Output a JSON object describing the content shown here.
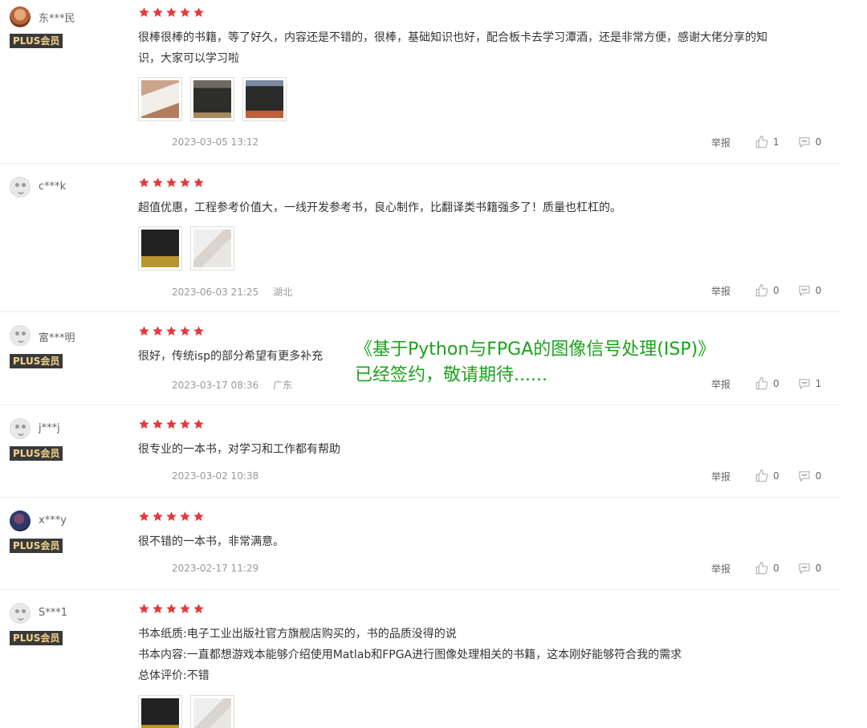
{
  "reviews": [
    {
      "username": "东***民",
      "avatar": "user-photo-avatar",
      "badge": "PLUS会员",
      "rating": 5,
      "text_lines": [
        "很棒很棒的书籍，等了好久，内容还是不错的，很棒，基础知识也好，配合板卡去学习潭酒，还是非常方便，感谢大佬分享的知",
        "识，大家可以学习啦"
      ],
      "images": 3,
      "date": "2023-03-05 13:12",
      "location": "",
      "report": "举报",
      "likes": "1",
      "comments": "0"
    },
    {
      "username": "c***k",
      "avatar": "default-avatar",
      "badge": "",
      "rating": 5,
      "text_lines": [
        "超值优惠，工程参考价值大，一线开发参考书，良心制作，比翻译类书籍强多了！质量也杠杠的。"
      ],
      "images": 2,
      "date": "2023-06-03 21:25",
      "location": "湖北",
      "report": "举报",
      "likes": "0",
      "comments": "0"
    },
    {
      "username": "富***明",
      "avatar": "default-avatar",
      "badge": "PLUS会员",
      "rating": 5,
      "text_lines": [
        "很好，传统isp的部分希望有更多补充"
      ],
      "images": 0,
      "date": "2023-03-17 08:36",
      "location": "广东",
      "report": "举报",
      "likes": "0",
      "comments": "1"
    },
    {
      "username": "j***j",
      "avatar": "default-avatar",
      "badge": "PLUS会员",
      "rating": 5,
      "text_lines": [
        "很专业的一本书，对学习和工作都有帮助"
      ],
      "images": 0,
      "date": "2023-03-02 10:38",
      "location": "",
      "report": "举报",
      "likes": "0",
      "comments": "0"
    },
    {
      "username": "x***y",
      "avatar": "user-photo-avatar",
      "badge": "PLUS会员",
      "rating": 5,
      "text_lines": [
        "很不错的一本书，非常满意。"
      ],
      "images": 0,
      "date": "2023-02-17 11:29",
      "location": "",
      "report": "举报",
      "likes": "0",
      "comments": "0"
    },
    {
      "username": "S***1",
      "avatar": "default-avatar",
      "badge": "PLUS会员",
      "rating": 5,
      "text_lines": [
        "书本纸质:电子工业出版社官方旗舰店购买的，书的品质没得的说",
        "书本内容:一直都想游戏本能够介绍使用Matlab和FPGA进行图像处理相关的书籍，这本刚好能够符合我的需求",
        "总体评价:不错"
      ],
      "images": 2,
      "date": "",
      "location": "",
      "report": "",
      "likes": "",
      "comments": ""
    }
  ],
  "overlay": {
    "line1": "《基于Python与FPGA的图像信号处理(ISP)》",
    "line2": "已经签约，敬请期待......"
  },
  "colors": {
    "star": "#e4393c",
    "overlay": "#1aa31a",
    "badge_bg": "#3a3a3a",
    "badge_fg": "#f3d28a"
  },
  "icons": {
    "like": "thumbs-up-icon",
    "comment": "speech-bubble-icon",
    "star": "star-icon"
  }
}
